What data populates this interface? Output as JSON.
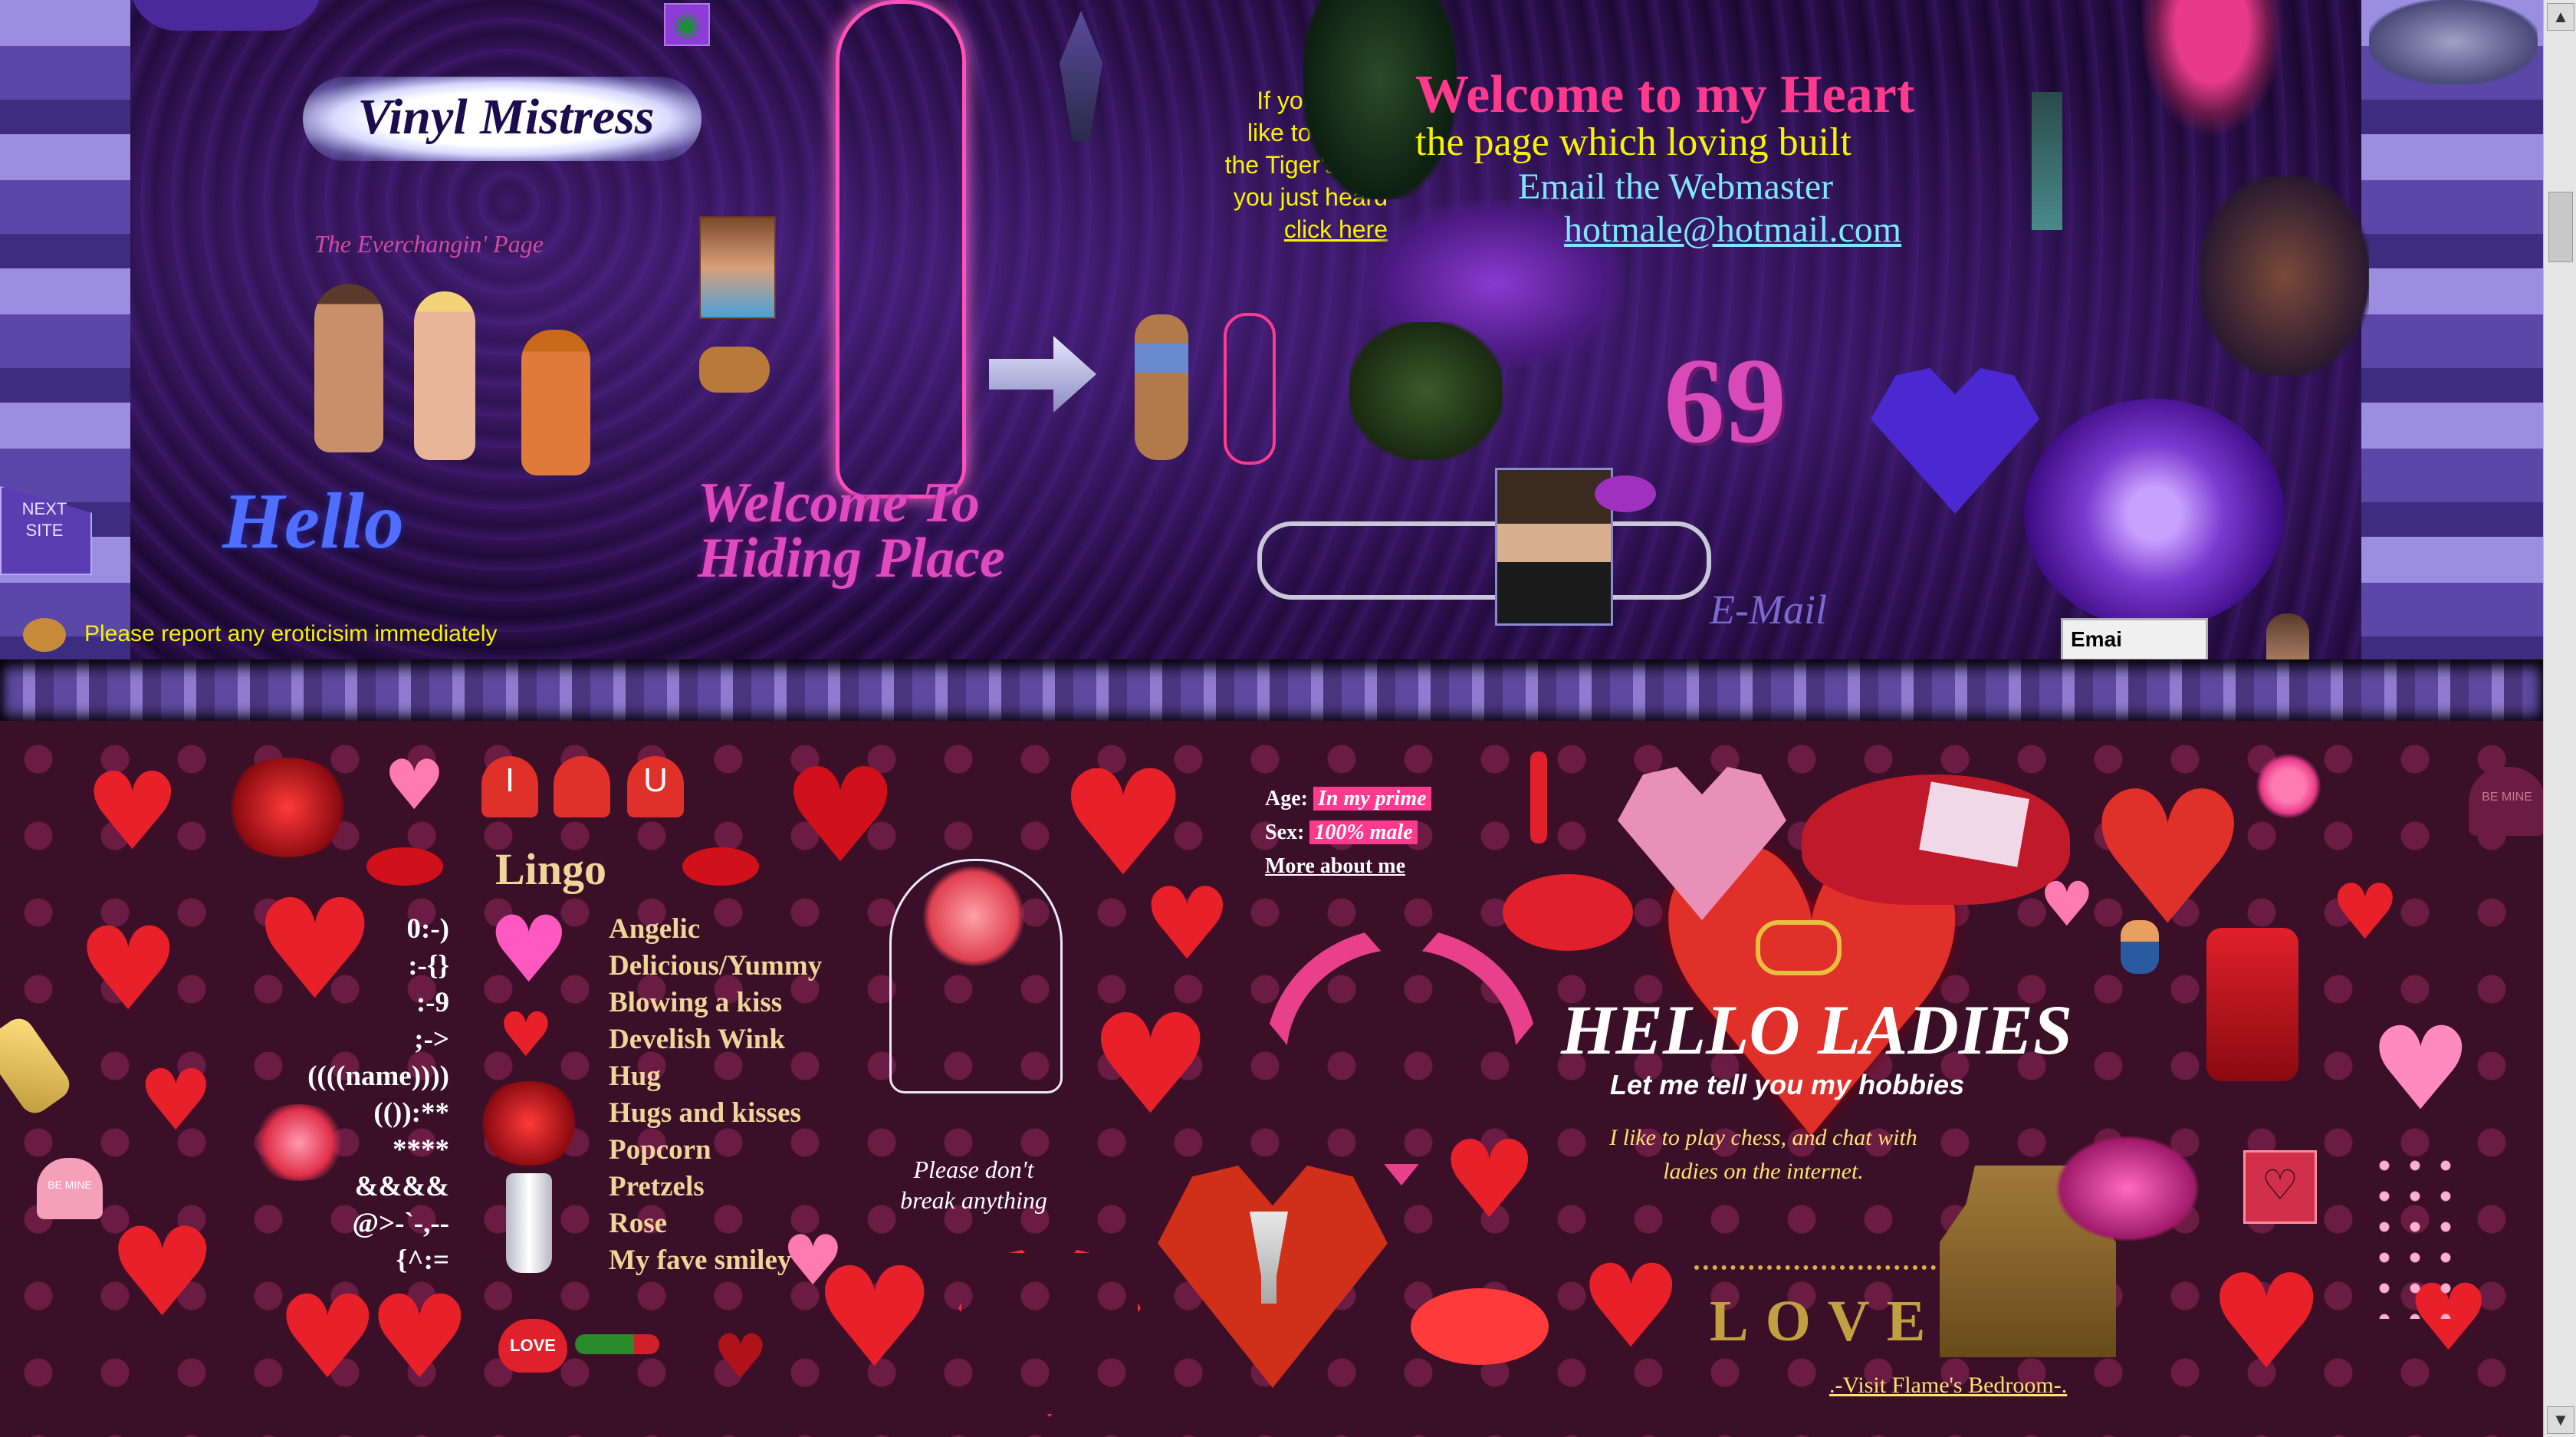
{
  "header": {
    "site_logo": "Vinyl Mistress",
    "tagline": "The Everchangin' Page",
    "hello": "Hello",
    "welcome_hiding": "Welcome To Hiding Place",
    "restart_note": [
      "If you would",
      "like to restart",
      "the Tiger's roar",
      "you just heard"
    ],
    "click_here": "click here",
    "welcome_heart": "Welcome to my Heart",
    "page_built": "the page which loving built",
    "email_webmaster": "Email the Webmaster",
    "email_address": "hotmale@hotmail.com",
    "number_badge": "69",
    "email_script": "E-Mail",
    "email_input_value": "Emai",
    "next_site": [
      "NEXT",
      "SITE"
    ],
    "report_notice": "Please report any eroticisim immediately"
  },
  "profile": {
    "age_label": "Age:",
    "age_value": "In my prime",
    "sex_label": "Sex:",
    "sex_value": "100% male",
    "more_link": "More about me"
  },
  "lingo": {
    "title": "Lingo",
    "rows": [
      {
        "code": "0:-)",
        "meaning": "Angelic"
      },
      {
        "code": ":-{}",
        "meaning": "Delicious/Yummy"
      },
      {
        "code": ":-9",
        "meaning": "Blowing a kiss"
      },
      {
        "code": ";->",
        "meaning": "Develish Wink"
      },
      {
        "code": "((((name))))",
        "meaning": "Hug"
      },
      {
        "code": "(()):**",
        "meaning": "Hugs and kisses"
      },
      {
        "code": "****",
        "meaning": "Popcorn"
      },
      {
        "code": "&&&&",
        "meaning": "Pretzels"
      },
      {
        "code": "@>-`-,--",
        "meaning": "Rose"
      },
      {
        "code": "{^:=",
        "meaning": "My fave smiley"
      }
    ]
  },
  "rose_dome_caption": [
    "Please don't",
    "break anything"
  ],
  "ladies": {
    "heading": "HELLO LADIES",
    "subheading": "Let me tell you my hobbies",
    "hobbies": [
      "I like to play chess, and chat with",
      "ladies on the internet."
    ],
    "love_word": "LOVE",
    "bedroom_link": ".-Visit Flame's Bedroom-."
  },
  "badges": {
    "love_tag": "LOVE",
    "be_mine_1": "BE MINE",
    "be_mine_2": "BE MINE",
    "heart_i": "I",
    "heart_u": "U"
  },
  "colors": {
    "top_bg": "#1d0a36",
    "bottom_bg": "#3a0f27",
    "accent_pink": "#ff3a8e",
    "link_cyan": "#7fe6ff",
    "yellow_text": "#f7f200",
    "lingo_gold": "#f3d39a"
  },
  "icons": [
    "eye-icon",
    "pointing-hand-icon",
    "arrow-right-icon",
    "lips-icon",
    "at-sign-icon",
    "rose-icon",
    "heart-icon",
    "chocolate-box-icon",
    "scroll-up-icon",
    "scroll-down-icon"
  ]
}
